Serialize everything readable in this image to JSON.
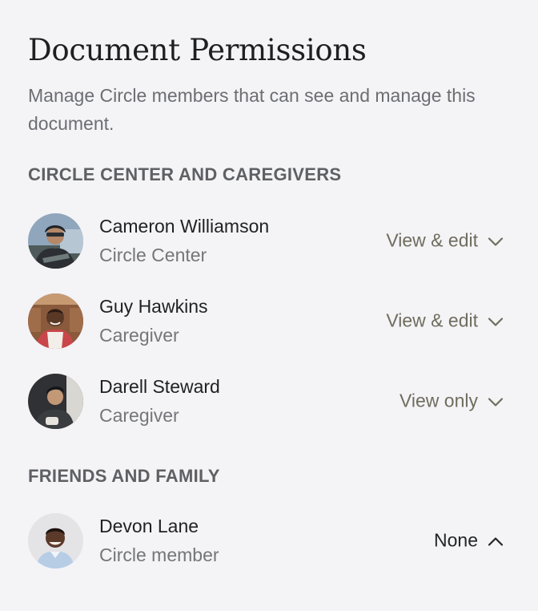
{
  "header": {
    "title": "Document Permissions",
    "subtitle": "Manage Circle members that can see and manage this document."
  },
  "sections": [
    {
      "heading": "CIRCLE CENTER AND CAREGIVERS",
      "members": [
        {
          "name": "Cameron Williamson",
          "role": "Circle Center",
          "permission": "View & edit",
          "chevron": "chevron-down-icon"
        },
        {
          "name": "Guy Hawkins",
          "role": "Caregiver",
          "permission": "View & edit",
          "chevron": "chevron-down-icon"
        },
        {
          "name": "Darell Steward",
          "role": "Caregiver",
          "permission": "View only",
          "chevron": "chevron-down-icon"
        }
      ]
    },
    {
      "heading": "FRIENDS AND FAMILY",
      "members": [
        {
          "name": "Devon Lane",
          "role": "Circle member",
          "permission": "None",
          "chevron": "chevron-up-icon"
        }
      ]
    }
  ],
  "colors": {
    "background": "#f4f3f6",
    "permission_text": "#6f6d5e",
    "permission_text_open": "#232528",
    "muted_text": "#74767a"
  }
}
